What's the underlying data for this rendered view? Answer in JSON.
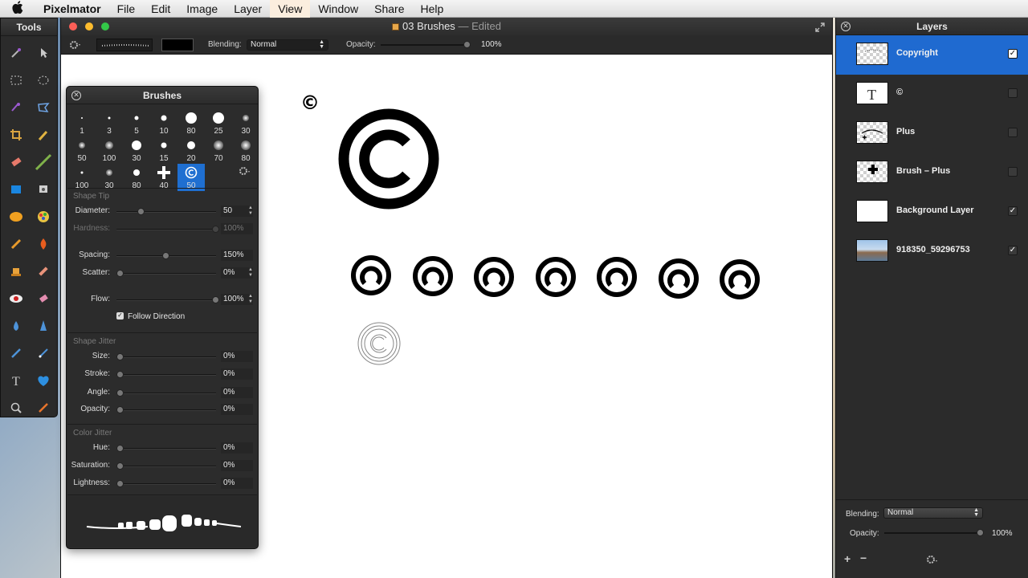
{
  "menubar": {
    "app_name": "Pixelmator",
    "items": [
      "File",
      "Edit",
      "Image",
      "Layer",
      "View",
      "Window",
      "Share",
      "Help"
    ]
  },
  "tools": {
    "title": "Tools"
  },
  "document": {
    "title": "03 Brushes",
    "status": "Edited",
    "toolbar": {
      "blending_label": "Blending:",
      "blending_value": "Normal",
      "opacity_label": "Opacity:",
      "opacity_value": "100%",
      "opacity_level": 1.0
    },
    "canvas": {
      "small_symbol": "©"
    }
  },
  "brushes": {
    "title": "Brushes",
    "presets": [
      "1",
      "3",
      "5",
      "10",
      "80",
      "25",
      "30",
      "50",
      "100",
      "30",
      "15",
      "20",
      "70",
      "80",
      "100",
      "30",
      "80",
      "40",
      "50"
    ],
    "shape_tip_label": "Shape Tip",
    "diameter": {
      "label": "Diameter:",
      "value": "50",
      "level": 0.22
    },
    "hardness": {
      "label": "Hardness:",
      "value": "100%",
      "level": 1.0
    },
    "spacing": {
      "label": "Spacing:",
      "value": "150%",
      "level": 0.48
    },
    "scatter": {
      "label": "Scatter:",
      "value": "0%",
      "level": 0
    },
    "flow": {
      "label": "Flow:",
      "value": "100%",
      "level": 1.0
    },
    "follow_direction": {
      "label": "Follow Direction",
      "checked": true
    },
    "shape_jitter_label": "Shape Jitter",
    "size": {
      "label": "Size:",
      "value": "0%",
      "level": 0
    },
    "stroke": {
      "label": "Stroke:",
      "value": "0%",
      "level": 0
    },
    "angle": {
      "label": "Angle:",
      "value": "0%",
      "level": 0
    },
    "opacity": {
      "label": "Opacity:",
      "value": "0%",
      "level": 0
    },
    "color_jitter_label": "Color Jitter",
    "hue": {
      "label": "Hue:",
      "value": "0%",
      "level": 0
    },
    "saturation": {
      "label": "Saturation:",
      "value": "0%",
      "level": 0
    },
    "lightness": {
      "label": "Lightness:",
      "value": "0%",
      "level": 0
    }
  },
  "layers": {
    "title": "Layers",
    "items": [
      {
        "name": "Copyright",
        "visible": true,
        "selected": true
      },
      {
        "name": "©",
        "visible": false,
        "selected": false
      },
      {
        "name": "Plus",
        "visible": false,
        "selected": false
      },
      {
        "name": "Brush – Plus",
        "visible": false,
        "selected": false
      },
      {
        "name": "Background Layer",
        "visible": true,
        "selected": false
      },
      {
        "name": "918350_59296753",
        "visible": true,
        "selected": false
      }
    ],
    "blending_label": "Blending:",
    "blending_value": "Normal",
    "opacity_label": "Opacity:",
    "opacity_value": "100%",
    "opacity_level": 1.0
  },
  "colors": {
    "accent": "#1f6fd1",
    "panel_bg": "#2b2b2b",
    "close": "#fc5f57",
    "minimize": "#fdbc2e",
    "zoom": "#33c748"
  },
  "icons": [
    "apple-icon",
    "magic-wand-icon",
    "arrow-icon",
    "rect-select-icon",
    "ellipse-select-icon",
    "lasso-icon",
    "polygon-lasso-icon",
    "crop-icon",
    "eyedropper-icon",
    "eraser-icon",
    "brush-icon",
    "rectangle-shape-icon",
    "stamp-icon",
    "sponge-icon",
    "color-wheel-icon",
    "paintbrush-icon",
    "burn-icon",
    "clone-icon",
    "healing-icon",
    "red-eye-icon",
    "smudge-icon",
    "blur-icon",
    "sharpen-icon",
    "pen-icon",
    "pencil-icon",
    "type-icon",
    "heart-icon",
    "zoom-icon",
    "color-picker-icon",
    "gear-icon",
    "close-icon",
    "fullscreen-icon",
    "plus-icon",
    "minus-icon"
  ]
}
